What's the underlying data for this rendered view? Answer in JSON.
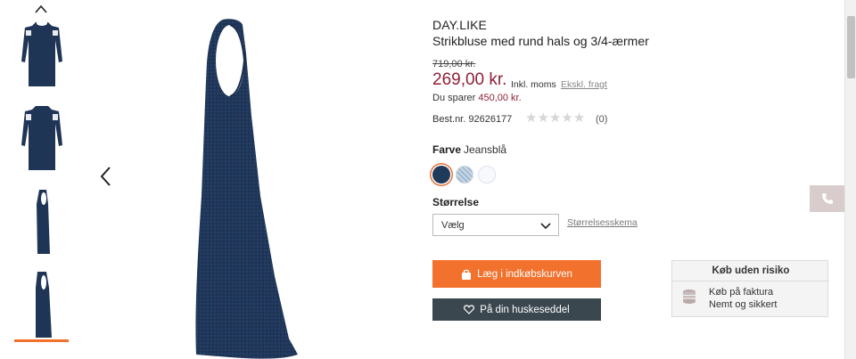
{
  "gallery": {
    "thumbnails": [
      "front-view",
      "back-view",
      "side-view",
      "side-view-2"
    ],
    "active_index": 3
  },
  "product": {
    "brand": "DAY.LIKE",
    "title": "Strikbluse med rund hals og 3/4-ærmer",
    "old_price": "719,00 kr.",
    "price": "269,00 kr.",
    "incl_vat": "Inkl. moms",
    "excl_vat_link": "Ekskl. fragt",
    "saving_prefix": "Du sparer",
    "saving_amount": "450,00 kr.",
    "item_number": "Best.nr. 92626177",
    "rating_stars": 0,
    "rating_count": "(0)"
  },
  "color": {
    "label": "Farve",
    "selected": "Jeansblå",
    "swatches": [
      "#203a5a",
      "#b1c7da",
      "#f7f9fc"
    ]
  },
  "size": {
    "label": "Størrelse",
    "select_value": "Vælg",
    "size_chart_link": "Størrelsesskema"
  },
  "actions": {
    "add_to_cart": "Læg i indkøbskurven",
    "wishlist": "På din huskeseddel"
  },
  "risk_box": {
    "title": "Køb uden risiko",
    "line1": "Køb på faktura",
    "line2": "Nemt og sikkert"
  },
  "colors": {
    "accent": "#f2712d",
    "price": "#8f2137",
    "dark_button": "#3b474f",
    "garment": "#1f3556"
  },
  "icons": [
    "chevron-up-icon",
    "chevron-left-icon",
    "chevron-down-icon",
    "star-icon",
    "shopping-bag-icon",
    "heart-icon",
    "coins-icon",
    "phone-icon"
  ]
}
